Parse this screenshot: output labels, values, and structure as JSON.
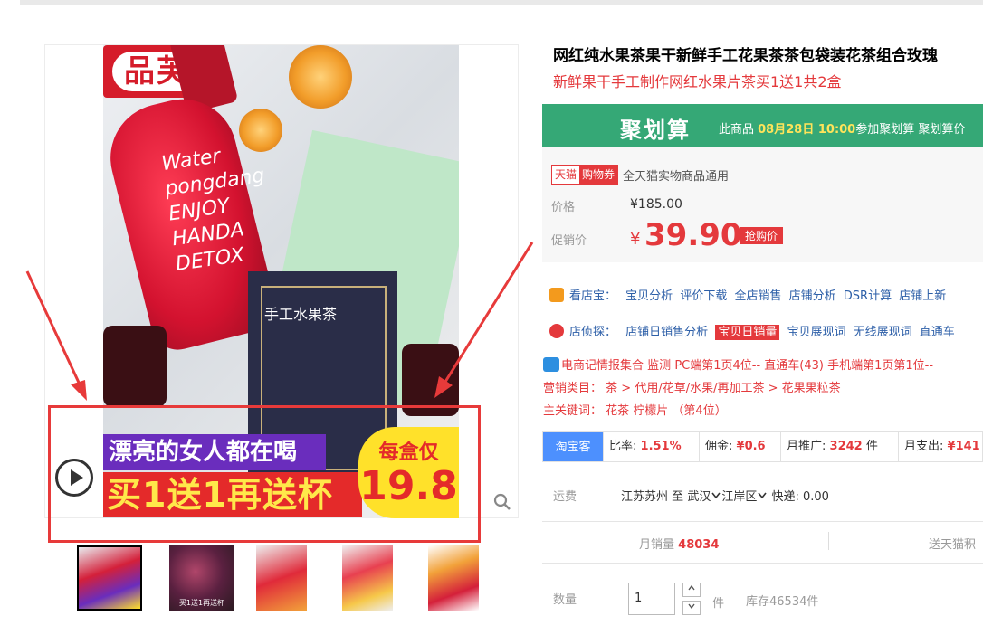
{
  "product": {
    "title": "网红纯水果茶果干新鲜手工花果茶茶包袋装花茶组合玫瑰",
    "subtitle": "新鲜果干手工制作网红水果片茶买1送1共2盒"
  },
  "gallery": {
    "brand_logo": "品芙",
    "bottle_text": "Water pongdang ENJOY HANDA DETOX",
    "box_label": "手工水果茶",
    "banner_top": "漂亮的女人都在喝",
    "banner_bottom": "买1送1再送杯",
    "banner_price_label": "每盒仅",
    "banner_price": "19.8",
    "thumb_caption": "买1送1再送杯"
  },
  "juhuasuan": {
    "logo": "聚划算",
    "text_prefix": "此商品 ",
    "date": "08月28日 10:00",
    "text_suffix": "参加聚划算 聚划算价"
  },
  "pricing": {
    "tmall_tag": "天猫",
    "coupon_tag": "购物券",
    "coupon_text": "全天猫实物商品通用",
    "price_label": "价格",
    "original_price": "185.00",
    "yen": "¥",
    "promo_label": "促销价",
    "promo_price": "39.90",
    "grab_tag": "抢购价"
  },
  "tools": {
    "row1_label": "看店宝：",
    "row1_links": [
      "宝贝分析",
      "评价下载",
      "全店销售",
      "店铺分析",
      "DSR计算",
      "店铺上新"
    ],
    "row2_label": "店侦探：",
    "row2_links": [
      "店铺日销售分析"
    ],
    "row2_highlight": "宝贝日销量",
    "row2_links_after": [
      "宝贝展现词",
      "无线展现词",
      "直通车"
    ]
  },
  "info": {
    "ecom_line_a": "电商记情报集合",
    "ecom_line_b": "监测",
    "ecom_line_c": "PC端第1页4位--",
    "ecom_line_d": "直通车(43) 手机端第1页第1位--",
    "category_label": "营销类目：",
    "category_path": "茶 > 代用/花草/水果/再加工茶 > 花果果粒茶",
    "keyword_label": "主关键词：",
    "keyword_value": "花茶 柠檬片 （第4位）"
  },
  "taobaoke": {
    "tag": "淘宝客",
    "rate_label": "比率:",
    "rate_value": "1.51%",
    "commission_label": "佣金:",
    "commission_value": "¥0.6",
    "promo_label": "月推广:",
    "promo_value": "3242",
    "promo_unit": "件",
    "spend_label": "月支出:",
    "spend_value": "¥141"
  },
  "shipping": {
    "label": "运费",
    "from": "江苏苏州",
    "to_word": "至",
    "city": "武汉",
    "district": "江岸区",
    "express": "快递: 0.00"
  },
  "sales": {
    "monthly_label": "月销量",
    "monthly_value": "48034",
    "points": "送天猫积"
  },
  "quantity": {
    "label": "数量",
    "value": "1",
    "unit": "件",
    "stock": "库存46534件"
  },
  "colors": {
    "accent_red": "#e4393c",
    "juhuasuan_green": "#35a876",
    "link_blue": "#2d5fa8",
    "taobaoke_blue": "#4d90fe"
  },
  "icons": [
    "play-icon",
    "zoom-icon",
    "kandianbao-icon",
    "diantanzhen-icon",
    "ecom-icon",
    "chevron-down-icon",
    "chevron-up-icon"
  ]
}
